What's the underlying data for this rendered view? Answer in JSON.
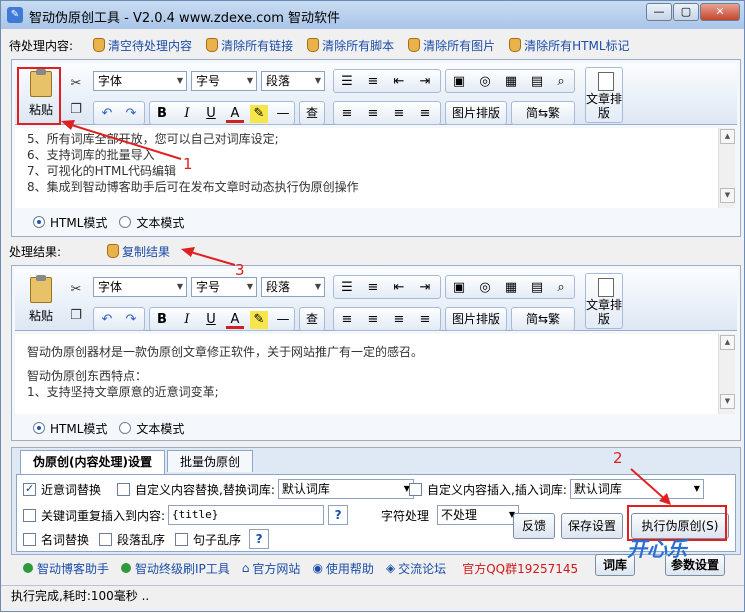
{
  "window": {
    "title": "智动伪原创工具   - V2.0.4  www.zdexe.com 智动软件",
    "min": "—",
    "max": "▢",
    "close": "✕"
  },
  "pending": {
    "label": "待处理内容:",
    "links": [
      "清空待处理内容",
      "清除所有链接",
      "清除所有脚本",
      "清除所有图片",
      "清除所有HTML标记"
    ],
    "lines": [
      "5、所有词库全部开放，您可以自己对词库设定;",
      "6、支持词库的批量导入",
      "7、可视化的HTML代码编辑",
      "8、集成到智动博客助手后可在发布文章时动态执行伪原创操作"
    ]
  },
  "result": {
    "label": "处理结果:",
    "copy": "复制结果",
    "lines": [
      "智动伪原创器材是一款伪原创文章修正软件，关于网站推广有一定的感召。",
      "智动伪原创东西特点：",
      "1、支持坚持文章原意的近意词变革;"
    ]
  },
  "toolbar": {
    "paste": "粘贴",
    "font": "字体",
    "size": "字号",
    "para": "段落",
    "img_layout": "图片排版",
    "conv": "简⇆繁",
    "text_layout": "文章排版",
    "bold": "B",
    "italic": "I",
    "underline": "U",
    "color": "A",
    "line": "—",
    "find": "查"
  },
  "modes": {
    "html": "HTML模式",
    "text": "文本模式"
  },
  "options": {
    "tabs": [
      "伪原创(内容处理)设置",
      "批量伪原创"
    ],
    "synonym": "近意词替换",
    "custom_replace": "自定义内容替换,替换词库:",
    "custom_replace_value": "默认词库",
    "custom_insert": "自定义内容插入,插入词库:",
    "custom_insert_value": "默认词库",
    "keyword_insert": "关键词重复插入到内容:",
    "keyword_value": "{title}",
    "char_label": "字符处理",
    "char_value": "不处理",
    "noun": "名词替换",
    "para_shuffle": "段落乱序",
    "sent_shuffle": "句子乱序",
    "help": "?",
    "feedback": "反馈",
    "save": "保存设置",
    "execute": "执行伪原创(S)"
  },
  "footer": {
    "links": [
      "智动博客助手",
      "智动终级刷IP工具",
      "官方网站",
      "使用帮助",
      "交流论坛"
    ],
    "qq": "官方QQ群19257145",
    "lib_btn": "词库",
    "settings_btn": "参数设置"
  },
  "status": "执行完成,耗时:100毫秒  ..",
  "annotations": {
    "n1": "1",
    "n2": "2",
    "n3": "3"
  },
  "watermark": "开心乐"
}
